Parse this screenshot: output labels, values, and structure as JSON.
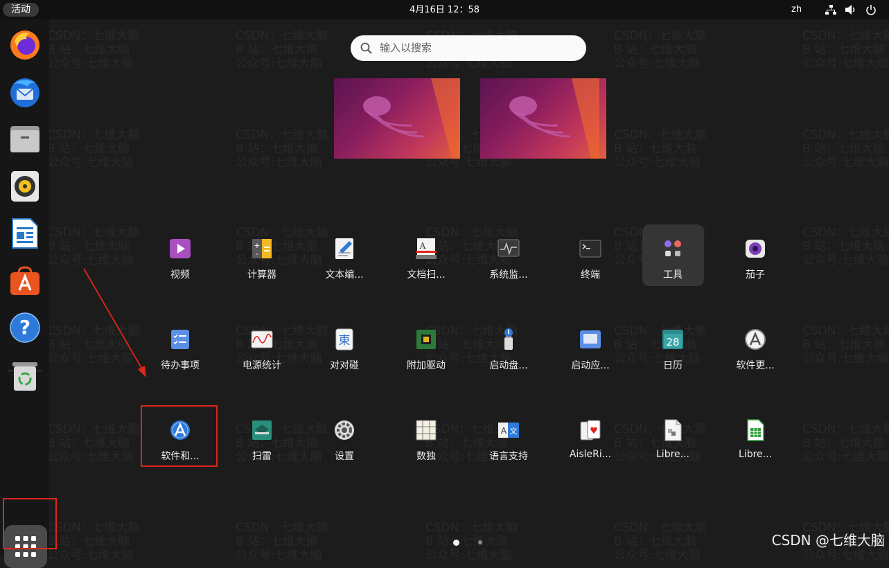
{
  "topbar": {
    "activities": "活动",
    "clock": "4月16日  12：58",
    "lang": "zh"
  },
  "dock": {
    "items": [
      "firefox-icon",
      "thunderbird-icon",
      "files-icon",
      "rhythmbox-icon",
      "libreoffice-writer-icon",
      "app-center-icon",
      "help-icon",
      "trash-icon"
    ],
    "show_apps": "grid-icon"
  },
  "search": {
    "placeholder": "输入以搜索"
  },
  "apps": {
    "row1": [
      "视频",
      "计算器",
      "文本编...",
      "文档扫...",
      "系统监...",
      "终端",
      "工具",
      "茄子"
    ],
    "row2": [
      "待办事项",
      "电源统计",
      "对对碰",
      "附加驱动",
      "启动盘...",
      "启动应...",
      "日历",
      "软件更..."
    ],
    "row3": [
      "软件和...",
      "扫雷",
      "设置",
      "数独",
      "语言支持",
      "AisleRi...",
      "Libre...",
      "Libre..."
    ]
  },
  "calendar_day": "28",
  "watermark": {
    "line1": "CSDN：七维大脑",
    "line2": "B 站：七维大脑",
    "line3": "公众号:七维大脑"
  },
  "corner_mark": "CSDN @七维大脑",
  "colors": {
    "highlight": "#e0251b",
    "accent": "#e95420"
  }
}
